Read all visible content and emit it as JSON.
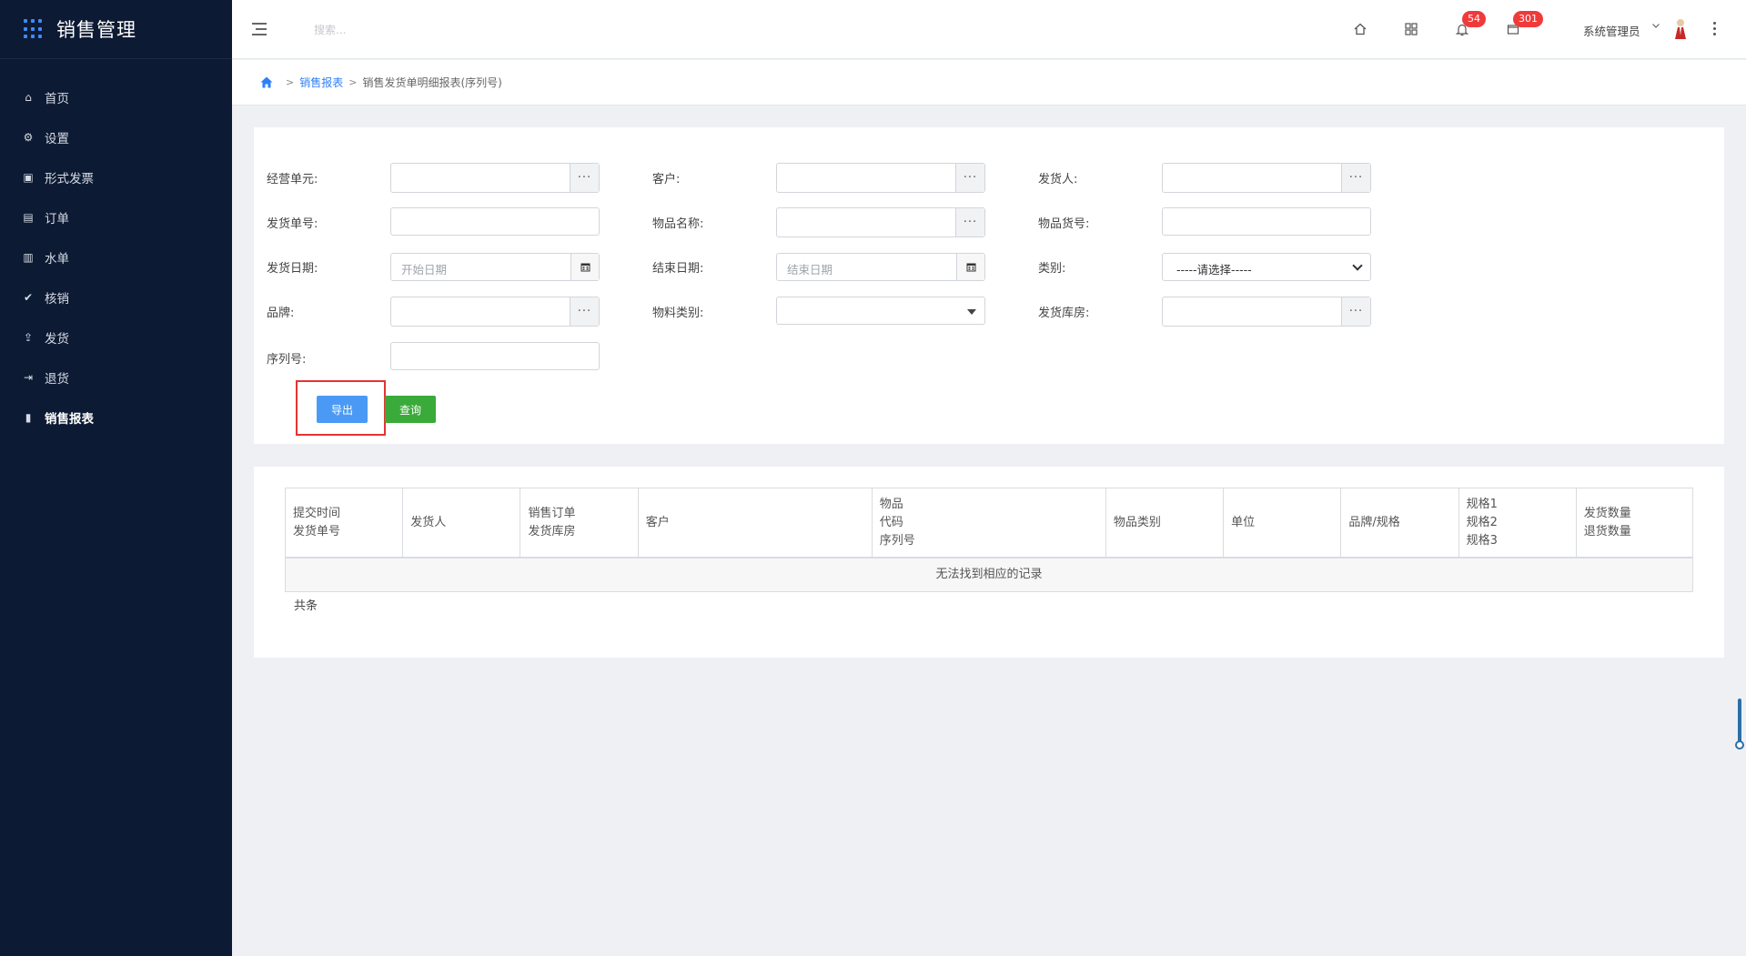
{
  "app": {
    "title": "销售管理"
  },
  "sidebar": {
    "items": [
      {
        "label": "首页",
        "icon": "home-icon",
        "glyph": "⌂"
      },
      {
        "label": "设置",
        "icon": "gear-icon",
        "glyph": "⚙"
      },
      {
        "label": "形式发票",
        "icon": "invoice-icon",
        "glyph": "▣"
      },
      {
        "label": "订单",
        "icon": "order-icon",
        "glyph": "▤"
      },
      {
        "label": "水单",
        "icon": "receipt-icon",
        "glyph": "▥"
      },
      {
        "label": "核销",
        "icon": "check-circle-icon",
        "glyph": "✔"
      },
      {
        "label": "发货",
        "icon": "upload-icon",
        "glyph": "⇪"
      },
      {
        "label": "退货",
        "icon": "return-icon",
        "glyph": "⇥"
      },
      {
        "label": "销售报表",
        "icon": "bar-chart-icon",
        "glyph": "▮"
      }
    ],
    "active_index": 8
  },
  "header": {
    "search_placeholder": "搜索...",
    "notifications_count": "54",
    "messages_count": "301",
    "user_name": "系统管理员"
  },
  "breadcrumb": {
    "link": "销售报表",
    "current": "销售发货单明细报表(序列号)"
  },
  "filters": {
    "business_unit_label": "经营单元:",
    "customer_label": "客户:",
    "shipper_label": "发货人:",
    "delivery_no_label": "发货单号:",
    "item_name_label": "物品名称:",
    "item_code_label": "物品货号:",
    "ship_date_label": "发货日期:",
    "ship_date_placeholder": "开始日期",
    "end_date_label": "结束日期:",
    "end_date_placeholder": "结束日期",
    "category_label": "类别:",
    "category_value": "-----请选择-----",
    "brand_label": "品牌:",
    "material_category_label": "物料类别:",
    "warehouse_label": "发货库房:",
    "serial_no_label": "序列号:",
    "ellipsis": "···"
  },
  "buttons": {
    "export": "导出",
    "query": "查询"
  },
  "table": {
    "columns": [
      {
        "lines": [
          "提交时间",
          "发货单号"
        ]
      },
      {
        "lines": [
          "发货人"
        ]
      },
      {
        "lines": [
          "销售订单",
          "发货库房"
        ]
      },
      {
        "lines": [
          "客户"
        ]
      },
      {
        "lines": [
          "物品",
          "代码",
          "序列号"
        ]
      },
      {
        "lines": [
          "物品类别"
        ]
      },
      {
        "lines": [
          "单位"
        ]
      },
      {
        "lines": [
          "品牌/规格"
        ]
      },
      {
        "lines": [
          "规格1",
          "规格2",
          "规格3"
        ]
      },
      {
        "lines": [
          "发货数量",
          "退货数量"
        ]
      }
    ],
    "empty_message": "无法找到相应的记录",
    "footer": "共条"
  }
}
